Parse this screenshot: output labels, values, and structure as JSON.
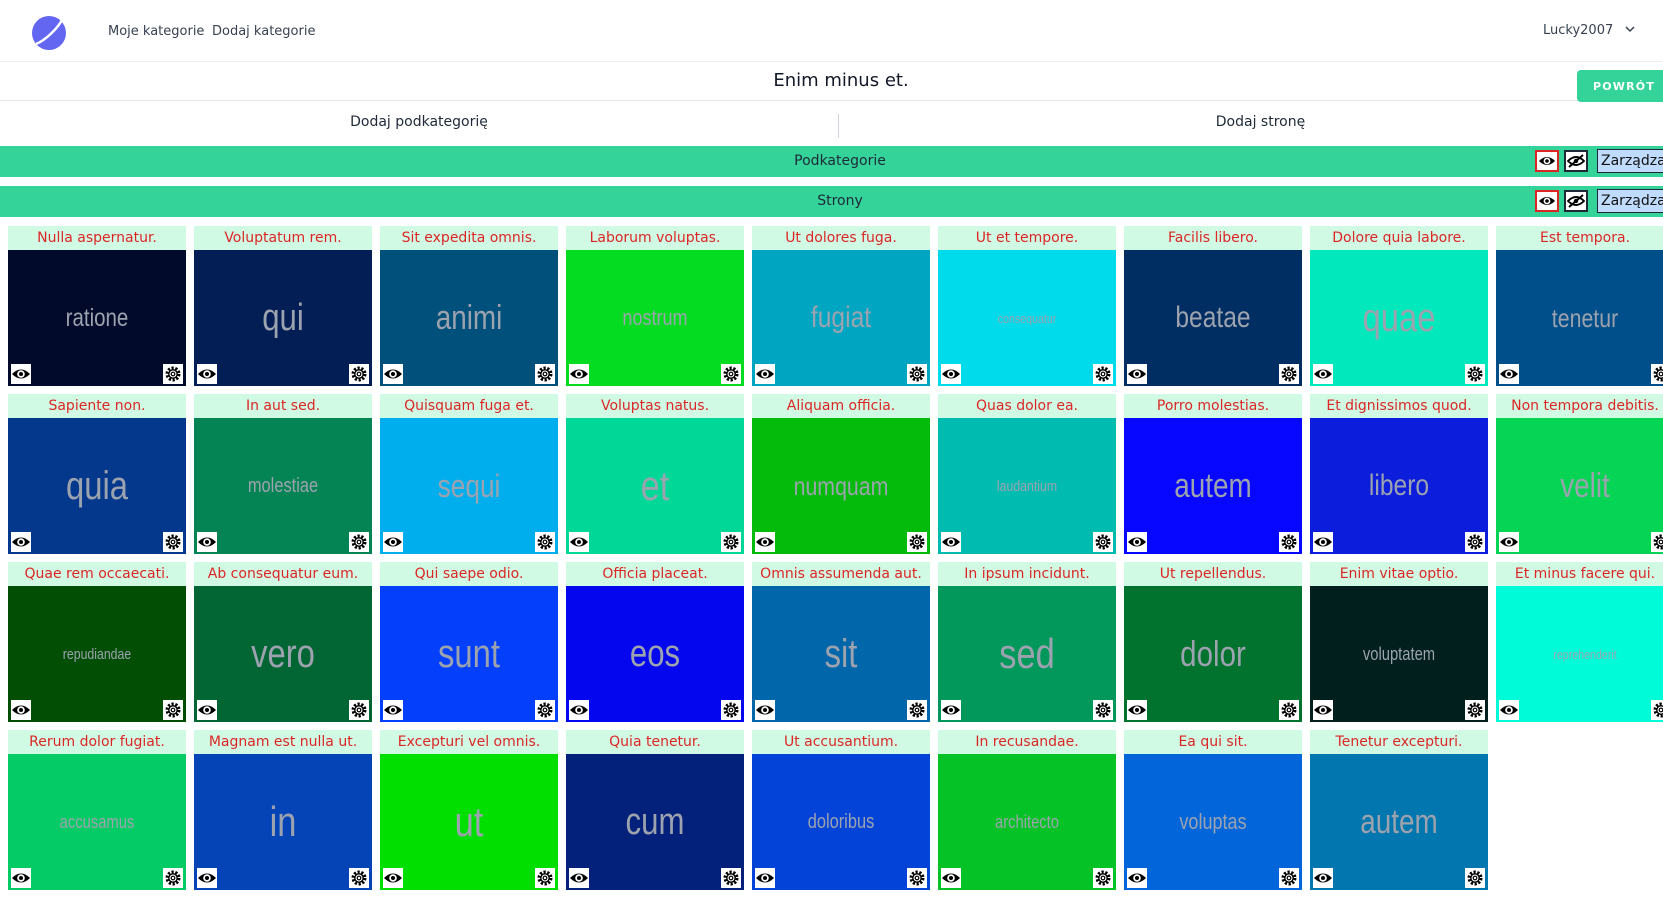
{
  "nav": {
    "links": [
      "Moje kategorie",
      "Dodaj kategorie"
    ],
    "user": "Lucky2007"
  },
  "page": {
    "title": "Enim minus et.",
    "back_label": "POWRÓT",
    "add_subcategory": "Dodaj podkategorię",
    "add_page": "Dodaj stronę"
  },
  "sections": [
    {
      "label": "Podkategorie",
      "manage_label": "Zarządzaj"
    },
    {
      "label": "Strony",
      "manage_label": "Zarządzaj"
    }
  ],
  "icons": {
    "eye": "eye-icon",
    "eye_off": "eye-off-icon",
    "gear": "gear-icon",
    "logo": "logo-icon",
    "chevron": "chevron-down-icon"
  },
  "colors": {
    "accent": "#34d399",
    "card_title_bg": "#d1fae5",
    "card_title_text": "#dc2626",
    "thumb_word": "#9ca3af"
  },
  "cards": [
    {
      "title": "Nulla aspernatur.",
      "word": "ratione",
      "color": "#010a2a",
      "size": 25
    },
    {
      "title": "Voluptatum rem.",
      "word": "qui",
      "color": "#031d55",
      "size": 38
    },
    {
      "title": "Sit expedita omnis.",
      "word": "animi",
      "color": "#00507c",
      "size": 34
    },
    {
      "title": "Laborum voluptas.",
      "word": "nostrum",
      "color": "#04dc22",
      "size": 22
    },
    {
      "title": "Ut dolores fuga.",
      "word": "fugiat",
      "color": "#00a5c2",
      "size": 30
    },
    {
      "title": "Ut et tempore.",
      "word": "consequatur",
      "color": "#00dbeb",
      "size": 13
    },
    {
      "title": "Facilis libero.",
      "word": "beatae",
      "color": "#002d62",
      "size": 30
    },
    {
      "title": "Dolore quia labore.",
      "word": "quae",
      "color": "#00e8bb",
      "size": 40
    },
    {
      "title": "Est tempora.",
      "word": "tenetur",
      "color": "#004e8a",
      "size": 26
    },
    {
      "title": "Sapiente non.",
      "word": "quia",
      "color": "#03388d",
      "size": 40
    },
    {
      "title": "In aut sed.",
      "word": "molestiae",
      "color": "#048454",
      "size": 20
    },
    {
      "title": "Quisquam fuga et.",
      "word": "sequi",
      "color": "#00aeee",
      "size": 32
    },
    {
      "title": "Voluptas natus.",
      "word": "et",
      "color": "#01d897",
      "size": 42
    },
    {
      "title": "Aliquam officia.",
      "word": "numquam",
      "color": "#04bb0b",
      "size": 26
    },
    {
      "title": "Quas dolor ea.",
      "word": "laudantium",
      "color": "#00bbb0",
      "size": 15
    },
    {
      "title": "Porro molestias.",
      "word": "autem",
      "color": "#0707ff",
      "size": 34
    },
    {
      "title": "Et dignissimos quod.",
      "word": "libero",
      "color": "#0d1ddc",
      "size": 30
    },
    {
      "title": "Non tempora debitis.",
      "word": "velit",
      "color": "#05d454",
      "size": 34
    },
    {
      "title": "Quae rem occaecati.",
      "word": "repudiandae",
      "color": "#024e05",
      "size": 15
    },
    {
      "title": "Ab consequatur eum.",
      "word": "vero",
      "color": "#026534",
      "size": 40
    },
    {
      "title": "Qui saepe odio.",
      "word": "sunt",
      "color": "#0440fb",
      "size": 40
    },
    {
      "title": "Officia placeat.",
      "word": "eos",
      "color": "#0407ee",
      "size": 38
    },
    {
      "title": "Omnis assumenda aut.",
      "word": "sit",
      "color": "#0266ab",
      "size": 40
    },
    {
      "title": "In ipsum incidunt.",
      "word": "sed",
      "color": "#02975b",
      "size": 42
    },
    {
      "title": "Ut repellendus.",
      "word": "dolor",
      "color": "#01732e",
      "size": 36
    },
    {
      "title": "Enim vitae optio.",
      "word": "voluptatem",
      "color": "#011f1c",
      "size": 18
    },
    {
      "title": "Et minus facere qui.",
      "word": "reprehenderit",
      "color": "#00fbd9",
      "size": 13
    },
    {
      "title": "Rerum dolor fugiat.",
      "word": "accusamus",
      "color": "#05cb66",
      "size": 18
    },
    {
      "title": "Magnam est nulla ut.",
      "word": "in",
      "color": "#0444b7",
      "size": 42
    },
    {
      "title": "Excepturi vel omnis.",
      "word": "ut",
      "color": "#00df00",
      "size": 42
    },
    {
      "title": "Quia tenetur.",
      "word": "cum",
      "color": "#03207a",
      "size": 38
    },
    {
      "title": "Ut accusantium.",
      "word": "doloribus",
      "color": "#0443d7",
      "size": 20
    },
    {
      "title": "In recusandae.",
      "word": "architecto",
      "color": "#05c326",
      "size": 18
    },
    {
      "title": "Ea qui sit.",
      "word": "voluptas",
      "color": "#0266da",
      "size": 22
    },
    {
      "title": "Tenetur excepturi.",
      "word": "autem",
      "color": "#0276ae",
      "size": 34
    }
  ]
}
